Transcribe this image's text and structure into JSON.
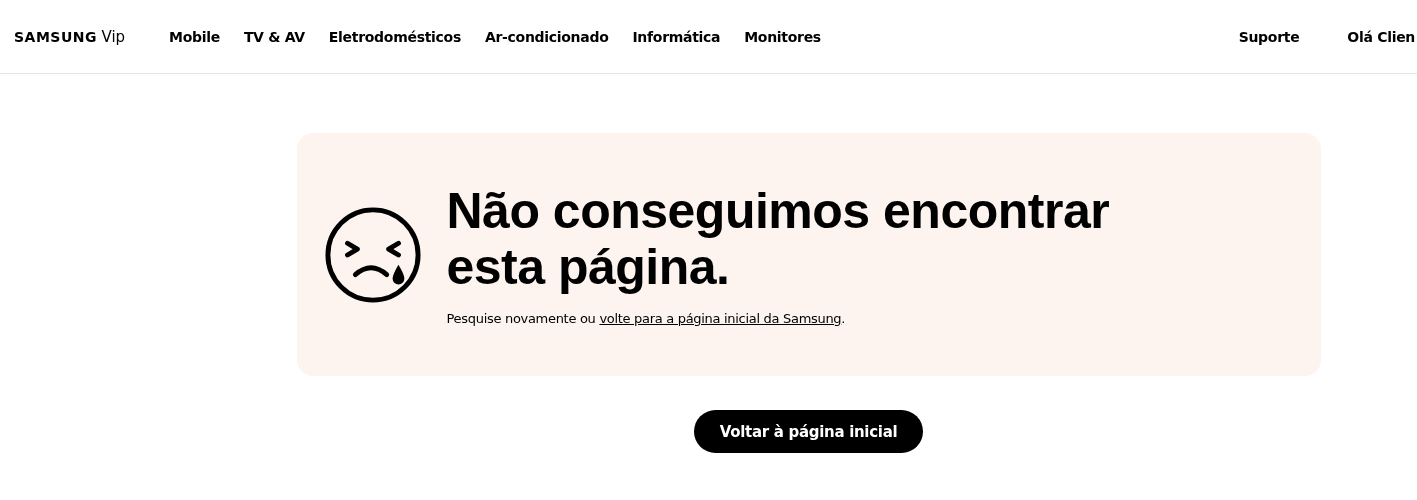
{
  "header": {
    "logo": "SAMSUNG",
    "logo_suffix": "Vip",
    "nav": [
      "Mobile",
      "TV & AV",
      "Eletrodomésticos",
      "Ar-condicionado",
      "Informática",
      "Monitores"
    ],
    "right_links": [
      "Suporte",
      "Olá Clien"
    ]
  },
  "error_card": {
    "heading": "Não conseguimos encontrar esta página.",
    "message": "Pesquise novamente ou ",
    "link": "volte para a página inicial da Samsung",
    "message_end": "."
  },
  "button": "Voltar à página inicial"
}
